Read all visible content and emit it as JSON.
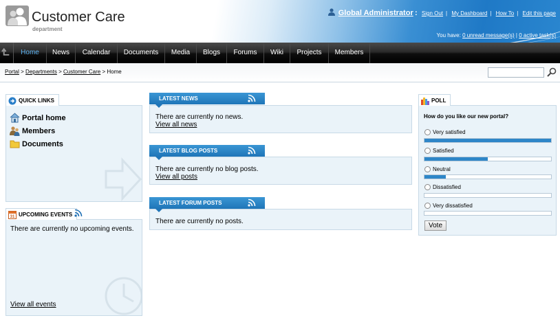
{
  "header": {
    "title": "Customer Care",
    "subtitle": "department",
    "user_name": "Global Administrator",
    "user_sep": ":",
    "links": [
      "Sign Out",
      "My Dashboard",
      "How To",
      "Edit this page"
    ],
    "msg_prefix": "You have:",
    "unread_link": "0 unread message(s)",
    "active_link": "0 active task(s)"
  },
  "nav": {
    "items": [
      "Home",
      "News",
      "Calendar",
      "Documents",
      "Media",
      "Blogs",
      "Forums",
      "Wiki",
      "Projects",
      "Members"
    ],
    "active": "Home"
  },
  "breadcrumb": {
    "items": [
      "Portal",
      "Departments",
      "Customer Care"
    ],
    "current": "Home",
    "separator": ">"
  },
  "quick_links": {
    "title": "QUICK LINKS",
    "items": [
      "Portal home",
      "Members",
      "Documents"
    ]
  },
  "upcoming_events": {
    "title": "UPCOMING EVENTS",
    "empty": "There are currently no upcoming events.",
    "view_all": "View all events"
  },
  "latest_news": {
    "title": "LATEST NEWS",
    "empty": "There are currently no news.",
    "view_all": "View all news"
  },
  "latest_blog": {
    "title": "LATEST BLOG POSTS",
    "empty": "There are currently no blog posts.",
    "view_all": "View all posts"
  },
  "latest_forum": {
    "title": "LATEST FORUM POSTS",
    "empty": "There are currently no posts."
  },
  "poll": {
    "title": "POLL",
    "question": "How do you like our new portal?",
    "options": [
      {
        "label": "Very satisfied",
        "fraction": 1.0
      },
      {
        "label": "Satisfied",
        "fraction": 0.5
      },
      {
        "label": "Neutral",
        "fraction": 0.17
      },
      {
        "label": "Dissatisfied",
        "fraction": 0.0
      },
      {
        "label": "Very dissatisfied",
        "fraction": 0.0
      }
    ],
    "vote_label": "Vote"
  },
  "colors": {
    "accent": "#2e86c8",
    "nav_active": "#5ab0ee",
    "panel_bg": "#eaf3f9"
  }
}
